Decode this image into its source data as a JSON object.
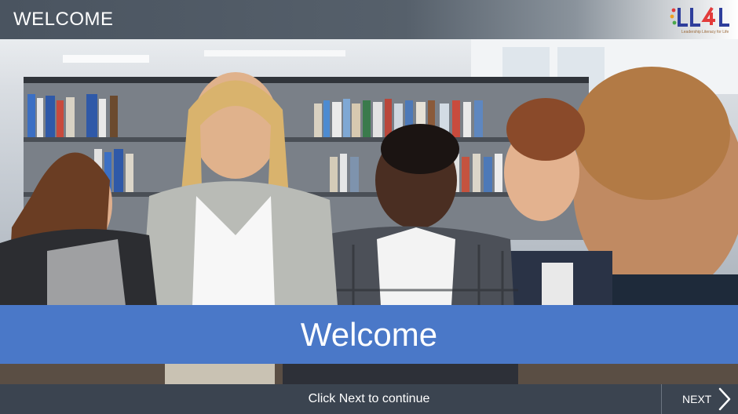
{
  "header": {
    "title": "WELCOME",
    "logo": {
      "text": "LL4L",
      "tagline": "Leadership Literacy for Life",
      "colors": [
        "#e23b3b",
        "#f0a020",
        "#4aa84a",
        "#2e3e9c"
      ]
    }
  },
  "photo": {
    "icon": "photo-classroom",
    "colors": {
      "banner": "#4a78c8",
      "footer": "#3b4450"
    }
  },
  "banner": {
    "text": "Welcome"
  },
  "footer": {
    "hint": "Click Next to continue",
    "next_label": "NEXT",
    "next_icon": "chevron-right-icon"
  }
}
